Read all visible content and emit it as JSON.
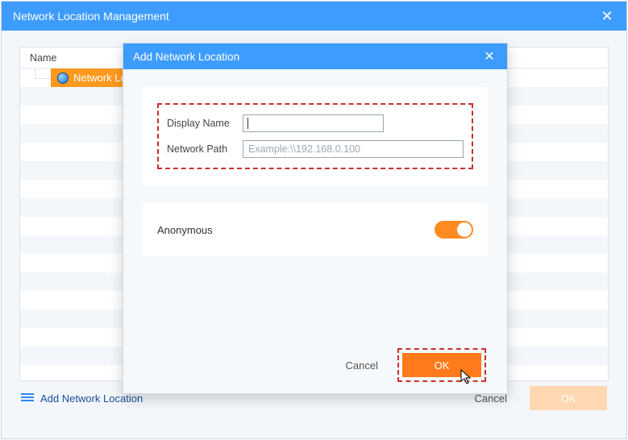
{
  "window": {
    "title": "Network Location Management"
  },
  "table": {
    "header": "Name",
    "selected_item": "Network Loc"
  },
  "footer": {
    "add_label": "Add Network Location",
    "cancel_label": "Cancel",
    "ok_label": "OK"
  },
  "dialog": {
    "title": "Add Network Location",
    "fields": {
      "display_name": {
        "label": "Display Name",
        "value": ""
      },
      "network_path": {
        "label": "Network Path",
        "value": "",
        "placeholder": "Example:\\\\192.168.0.100"
      }
    },
    "anonymous": {
      "label": "Anonymous",
      "enabled": true
    },
    "buttons": {
      "cancel": "Cancel",
      "ok": "OK"
    }
  }
}
